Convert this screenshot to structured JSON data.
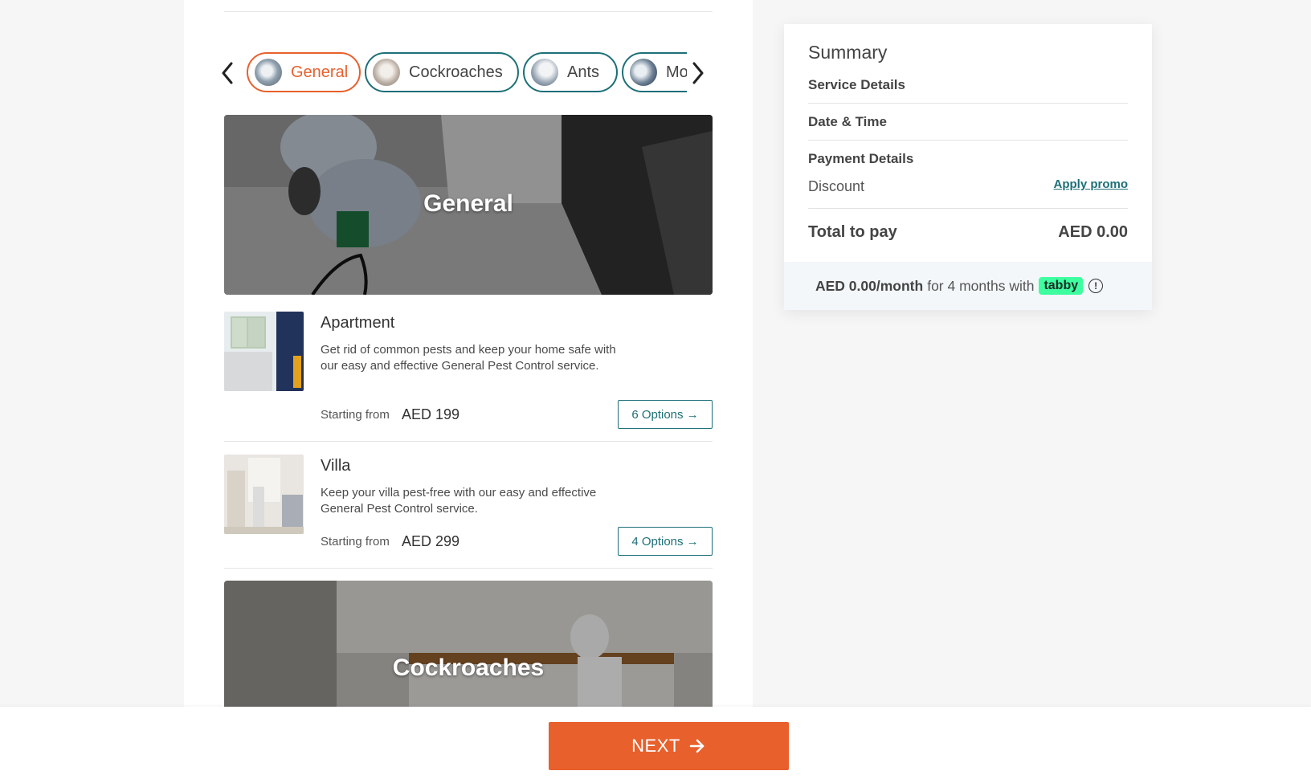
{
  "categories": {
    "items": [
      {
        "label": "General",
        "active": true
      },
      {
        "label": "Cockroaches",
        "active": false
      },
      {
        "label": "Ants",
        "active": false
      },
      {
        "label": "Mosquitoes",
        "active": false
      }
    ]
  },
  "sections": [
    {
      "title": "General",
      "services": [
        {
          "name": "Apartment",
          "description": "Get rid of common pests and keep your home safe with our easy and effective General Pest Control service.",
          "starting_label": "Starting from",
          "price": "AED 199",
          "options_label": "6 Options →"
        },
        {
          "name": "Villa",
          "description": "Keep your villa pest-free with our easy and effective General Pest Control service.",
          "starting_label": "Starting from",
          "price": "AED 299",
          "options_label": "4 Options →"
        }
      ]
    },
    {
      "title": "Cockroaches",
      "services": []
    }
  ],
  "summary": {
    "title": "Summary",
    "service_details": "Service Details",
    "date_time": "Date & Time",
    "payment_details": "Payment Details",
    "discount": "Discount",
    "apply_promo": "Apply promo",
    "total_label": "Total to pay",
    "total_value": "AED 0.00",
    "tabby": {
      "amount": "AED 0.00/month",
      "text": "for 4 months with",
      "logo": "tabby",
      "info_icon": "info-circle-icon"
    }
  },
  "footer": {
    "next_label": "NEXT",
    "next_icon": "arrow-right-icon"
  },
  "colors": {
    "accent": "#e8602c",
    "teal": "#1d6f78",
    "tabby_green": "#3dffa0"
  }
}
